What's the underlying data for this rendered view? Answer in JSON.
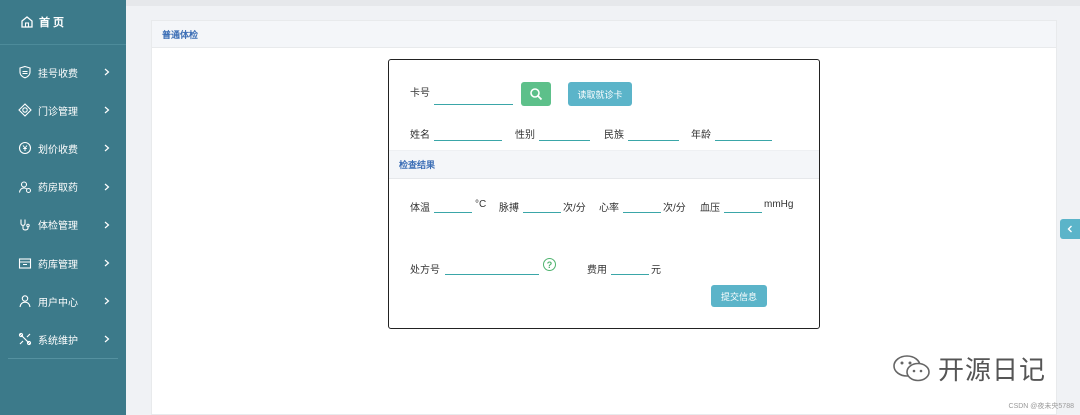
{
  "sidebar": {
    "home_label": "首 页",
    "items": [
      {
        "label": "挂号收费",
        "icon": "shield-icon"
      },
      {
        "label": "门诊管理",
        "icon": "diamond-gear-icon"
      },
      {
        "label": "划价收费",
        "icon": "money-icon"
      },
      {
        "label": "药房取药",
        "icon": "user-pharmacy-icon"
      },
      {
        "label": "体检管理",
        "icon": "stethoscope-icon"
      },
      {
        "label": "药库管理",
        "icon": "warehouse-icon"
      },
      {
        "label": "用户中心",
        "icon": "user-icon"
      },
      {
        "label": "系统维护",
        "icon": "tools-icon"
      }
    ]
  },
  "panel": {
    "title": "普通体检"
  },
  "form": {
    "card_label": "卡号",
    "read_card_button": "读取就诊卡",
    "name_label": "姓名",
    "gender_label": "性别",
    "ethnicity_label": "民族",
    "age_label": "年龄",
    "section_title": "检查结果",
    "temp_label": "体温",
    "temp_unit": "°C",
    "pulse_label": "脉搏",
    "pulse_unit": "次/分",
    "heart_label": "心率",
    "heart_unit": "次/分",
    "bp_label": "血压",
    "bp_unit": "mmHg",
    "rx_label": "处方号",
    "help_glyph": "?",
    "fee_label": "费用",
    "fee_unit": "元",
    "submit_button": "提交信息"
  },
  "watermark": {
    "text": "开源日记",
    "csdn": "CSDN @夜未央5788"
  },
  "colors": {
    "sidebar": "#3c7a8a",
    "accent": "#5bb4c9",
    "search_button": "#5dc08a",
    "section_title": "#3d6fb6"
  }
}
